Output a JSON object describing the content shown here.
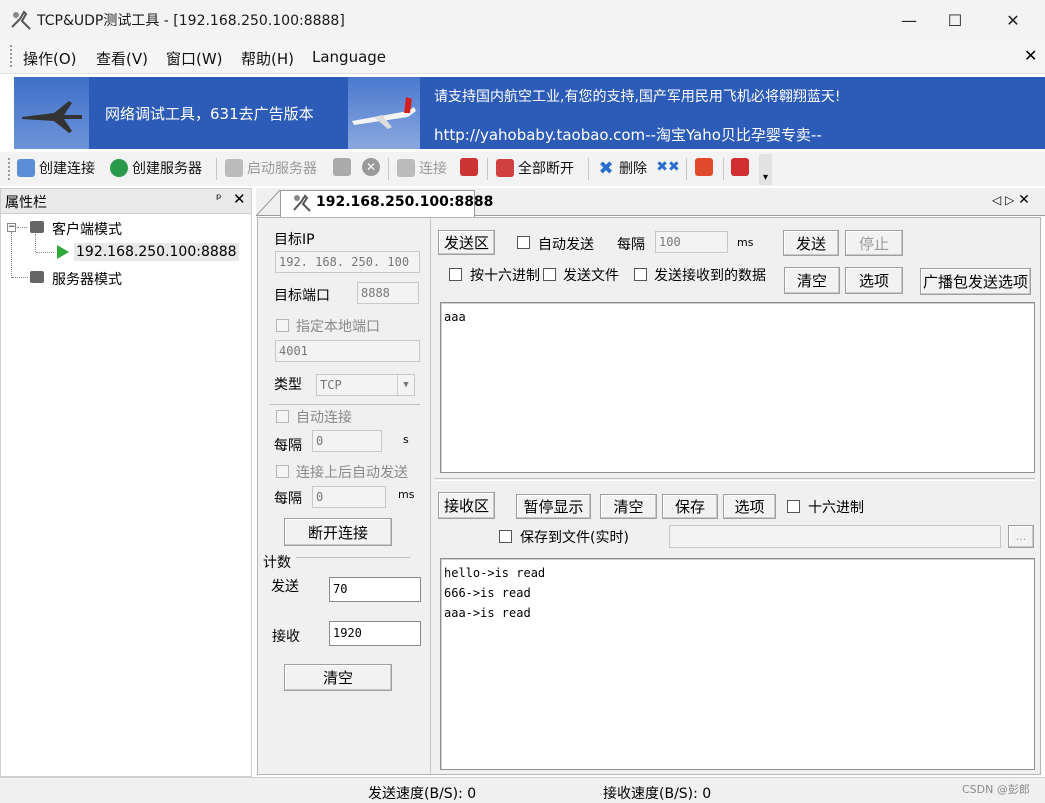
{
  "window": {
    "title": "TCP&UDP测试工具 - [192.168.250.100:8888]"
  },
  "menu": {
    "items": [
      "操作(O)",
      "查看(V)",
      "窗口(W)",
      "帮助(H)",
      "Language"
    ]
  },
  "banner": {
    "left_text": "网络调试工具，631去广告版本",
    "right_line1": "请支持国内航空工业,有您的支持,国产军用民用飞机必将翱翔蓝天!",
    "right_line2": "http://yahobaby.taobao.com--淘宝Yaho贝比孕婴专卖--"
  },
  "toolbar": {
    "create_connection": "创建连接",
    "create_server": "创建服务器",
    "start_server": "启动服务器",
    "connect": "连接",
    "disconnect_all": "全部断开",
    "delete": "删除"
  },
  "sidebar": {
    "title": "属性栏",
    "pin": "ᵖ",
    "client_mode": "客户端模式",
    "client_item": "192.168.250.100:8888",
    "server_mode": "服务器模式"
  },
  "tab": {
    "label": "192.168.250.100:8888"
  },
  "conn": {
    "target_ip_label": "目标IP",
    "target_ip": "192. 168. 250. 100",
    "target_port_label": "目标端口",
    "target_port": "8888",
    "local_port_label": "指定本地端口",
    "local_port": "4001",
    "type_label": "类型",
    "type_value": "TCP",
    "auto_connect_label": "自动连接",
    "interval_label": "每隔",
    "interval1_value": "0",
    "interval1_unit": "s",
    "auto_send_label": "连接上后自动发送",
    "interval2_value": "0",
    "interval2_unit": "ms",
    "disconnect_button": "断开连接"
  },
  "counter": {
    "title": "计数",
    "send_label": "发送",
    "send_value": "70",
    "recv_label": "接收",
    "recv_value": "1920",
    "clear_button": "清空"
  },
  "send_area": {
    "title": "发送区",
    "auto_send": "自动发送",
    "interval_label": "每隔",
    "interval_value": "100",
    "interval_unit": "ms",
    "send_button": "发送",
    "stop_button": "停止",
    "hex_send": "按十六进制",
    "send_file": "发送文件",
    "send_received": "发送接收到的数据",
    "clear_button": "清空",
    "options_button": "选项",
    "broadcast_button": "广播包发送选项",
    "content": "aaa"
  },
  "recv_area": {
    "title": "接收区",
    "pause_button": "暂停显示",
    "clear_button": "清空",
    "save_button": "保存",
    "options_button": "选项",
    "hex_label": "十六进制",
    "save_to_file": "保存到文件(实时)",
    "browse_button": "...",
    "lines": [
      "hello->is read",
      "666->is read",
      "aaa->is read"
    ]
  },
  "status": {
    "send_speed": "发送速度(B/S): 0",
    "recv_speed": "接收速度(B/S): 0",
    "watermark": "CSDN @彭郎"
  }
}
